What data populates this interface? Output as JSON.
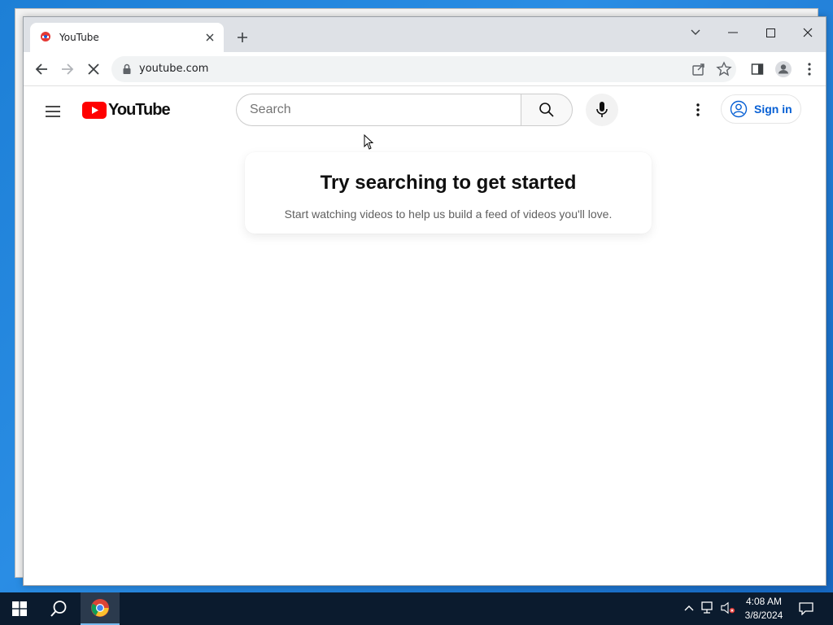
{
  "browser": {
    "tab": {
      "title": "YouTube",
      "favicon": "youtube-favicon-icon"
    },
    "url": "youtube.com",
    "window_controls": [
      "tab-search",
      "minimize",
      "maximize",
      "close"
    ]
  },
  "youtube": {
    "logo_text": "YouTube",
    "search_placeholder": "Search",
    "signin_label": "Sign in",
    "card": {
      "title": "Try searching to get started",
      "subtitle": "Start watching videos to help us build a feed of videos you'll love."
    }
  },
  "taskbar": {
    "time": "4:08 AM",
    "date": "3/8/2024"
  },
  "colors": {
    "youtube_red": "#ff0000",
    "link_blue": "#065fd4",
    "taskbar": "#0b1b2e"
  }
}
